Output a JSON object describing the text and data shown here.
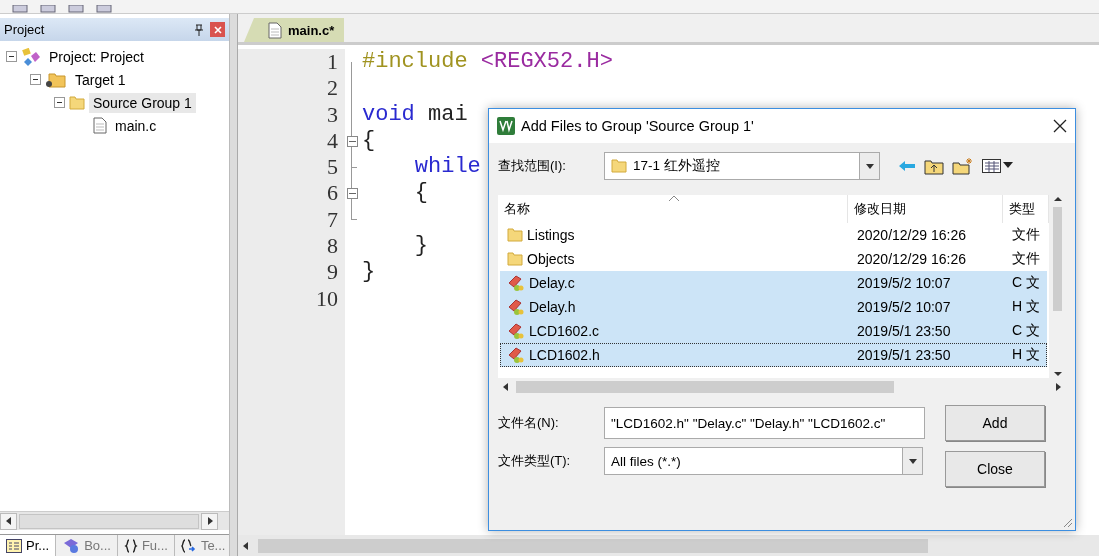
{
  "project_panel": {
    "title": "Project",
    "tree": [
      {
        "label": "Project: Project",
        "kind": "project",
        "expanded": true,
        "selected": false,
        "children": [
          {
            "label": "Target 1",
            "kind": "target",
            "expanded": true,
            "selected": false,
            "children": [
              {
                "label": "Source Group 1",
                "kind": "group",
                "expanded": true,
                "selected": true,
                "children": [
                  {
                    "label": "main.c",
                    "kind": "file",
                    "selected": false
                  }
                ]
              }
            ]
          }
        ]
      }
    ],
    "bottom_tabs": [
      {
        "label": "Pr...",
        "kind": "project",
        "selected": true
      },
      {
        "label": "Bo...",
        "kind": "books",
        "selected": false
      },
      {
        "label": "Fu...",
        "kind": "functions",
        "selected": false
      },
      {
        "label": "Te...",
        "kind": "templates",
        "selected": false
      }
    ]
  },
  "editor": {
    "tab": {
      "label": "main.c*",
      "selected": true
    },
    "lines": [
      {
        "number": "1",
        "segments": [
          {
            "text": "#include",
            "kind": "preprocessor"
          },
          {
            "text": "<REGX52.H>",
            "kind": "string"
          }
        ]
      },
      {
        "number": "2"
      },
      {
        "number": "3",
        "segments": [
          {
            "text": "void",
            "kind": "keyword"
          },
          {
            "text": "mai"
          }
        ]
      },
      {
        "number": "4",
        "fold_box": true,
        "segments": [
          {
            "text": "{"
          }
        ]
      },
      {
        "number": "5",
        "segments": [
          {
            "text": "    while",
            "kind": "keyword"
          }
        ]
      },
      {
        "number": "6",
        "fold_box": true,
        "segments": [
          {
            "text": "    {"
          }
        ]
      },
      {
        "number": "7"
      },
      {
        "number": "8",
        "segments": [
          {
            "text": "    }"
          }
        ]
      },
      {
        "number": "9",
        "segments": [
          {
            "text": "}"
          }
        ]
      },
      {
        "number": "10"
      }
    ]
  },
  "dialog": {
    "title": "Add Files to Group 'Source Group 1'",
    "look_in": {
      "label": "查找范围(I):",
      "value": "17-1 红外遥控"
    },
    "columns": [
      "名称",
      "修改日期",
      "类型"
    ],
    "rows": [
      {
        "name": "Listings",
        "kind": "folder",
        "date": "2020/12/29 16:26",
        "type": "文件",
        "selected": false,
        "focused": false
      },
      {
        "name": "Objects",
        "kind": "folder",
        "date": "2020/12/29 16:26",
        "type": "文件",
        "selected": false,
        "focused": false
      },
      {
        "name": "Delay.c",
        "kind": "file",
        "date": "2019/5/2 10:07",
        "type": "C 文",
        "selected": true,
        "focused": false
      },
      {
        "name": "Delay.h",
        "kind": "file",
        "date": "2019/5/2 10:07",
        "type": "H 文",
        "selected": true,
        "focused": false
      },
      {
        "name": "LCD1602.c",
        "kind": "file",
        "date": "2019/5/1 23:50",
        "type": "C 文",
        "selected": true,
        "focused": false
      },
      {
        "name": "LCD1602.h",
        "kind": "file",
        "date": "2019/5/1 23:50",
        "type": "H 文",
        "selected": true,
        "focused": true
      }
    ],
    "file_name": {
      "label": "文件名(N):",
      "value": "\"LCD1602.h\" \"Delay.c\" \"Delay.h\" \"LCD1602.c\""
    },
    "file_type": {
      "label": "文件类型(T):",
      "value": "All files (*.*)"
    },
    "buttons": [
      "Add",
      "Close"
    ]
  }
}
